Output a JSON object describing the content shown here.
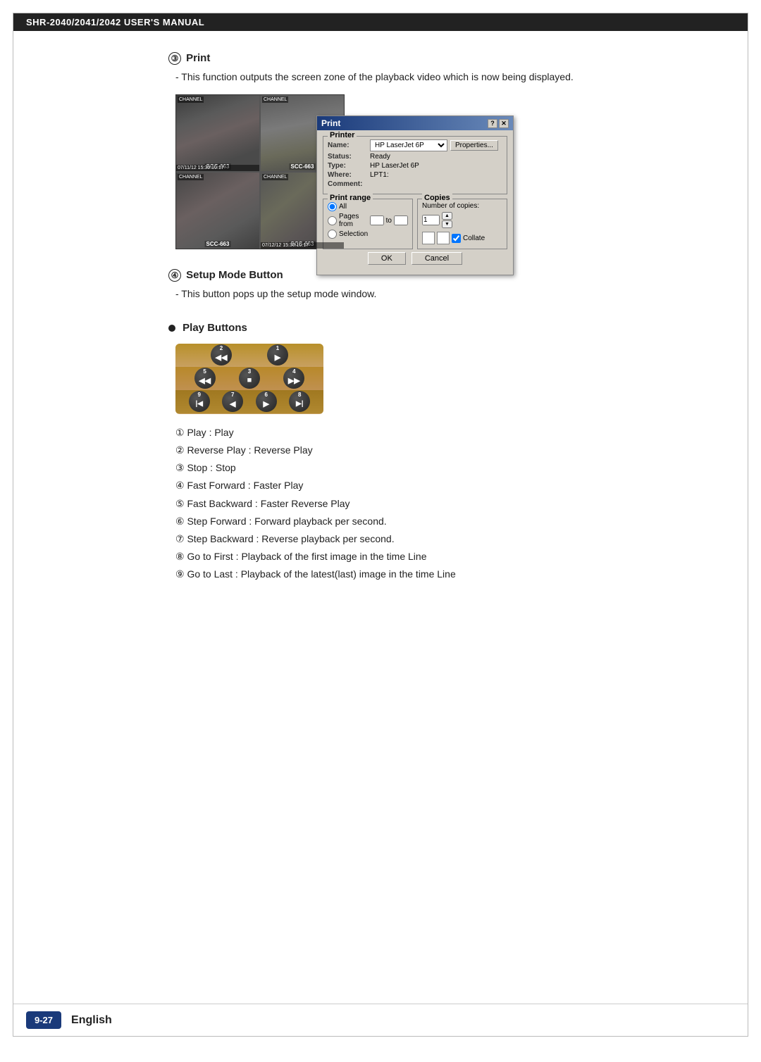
{
  "header": {
    "title": "SHR-2040/2041/2042 USER'S MANUAL"
  },
  "sections": {
    "print": {
      "number": "③",
      "title": "Print",
      "desc": "- This function outputs the screen zone of the playback video which is now being displayed."
    },
    "setup": {
      "number": "④",
      "title": "Setup Mode Button",
      "desc": "- This button pops up the setup mode window."
    },
    "playButtons": {
      "bullet": "●",
      "title": "Play Buttons",
      "buttons": [
        {
          "num": "2",
          "icon": "◀◀"
        },
        {
          "num": "1",
          "icon": "▶"
        },
        {
          "num": "5",
          "icon": "◀◀"
        },
        {
          "num": "3",
          "icon": "■"
        },
        {
          "num": "4",
          "icon": "▶▶"
        },
        {
          "num": "9",
          "icon": "|◀"
        },
        {
          "num": "7",
          "icon": "◀"
        },
        {
          "num": "6",
          "icon": "▶"
        },
        {
          "num": "8",
          "icon": "▶|"
        }
      ],
      "descriptions": [
        "① Play : Play",
        "② Reverse Play : Reverse Play",
        "③ Stop : Stop",
        "④ Fast Forward : Faster Play",
        "⑤ Fast Backward : Faster Reverse Play",
        "⑥ Step Forward : Forward playback per second.",
        "⑦ Step Backward : Reverse playback per second.",
        "⑧ Go to First : Playback of the first image in the time Line",
        "⑨ Go to Last : Playback of the latest(last) image in the time Line"
      ]
    }
  },
  "dialog": {
    "title": "Print",
    "printer_group": "Printer",
    "name_label": "Name:",
    "name_value": "HP LaserJet 6P",
    "status_label": "Status:",
    "status_value": "Ready",
    "type_label": "Type:",
    "type_value": "HP LaserJet 6P",
    "where_label": "Where:",
    "where_value": "LPT1:",
    "comment_label": "Comment:",
    "comment_value": "",
    "properties_btn": "Properties...",
    "print_range_title": "Print range",
    "all_label": "All",
    "pages_label": "Pages from",
    "to_label": "to",
    "selection_label": "Selection",
    "copies_title": "Copies",
    "num_copies_label": "Number of copies:",
    "num_copies_value": "1",
    "collate_label": "Collate",
    "ok_label": "OK",
    "cancel_label": "Cancel"
  },
  "cameras": [
    {
      "label": "SCC-663",
      "timestamp": "07/11/12 15:30:10:17"
    },
    {
      "label": "SCC-663",
      "timestamp": ""
    },
    {
      "label": "SCC-663",
      "timestamp": ""
    },
    {
      "label": "SCC-663",
      "timestamp": "07/12/12 15:30:10:17"
    }
  ],
  "footer": {
    "badge": "9-27",
    "language": "English"
  }
}
